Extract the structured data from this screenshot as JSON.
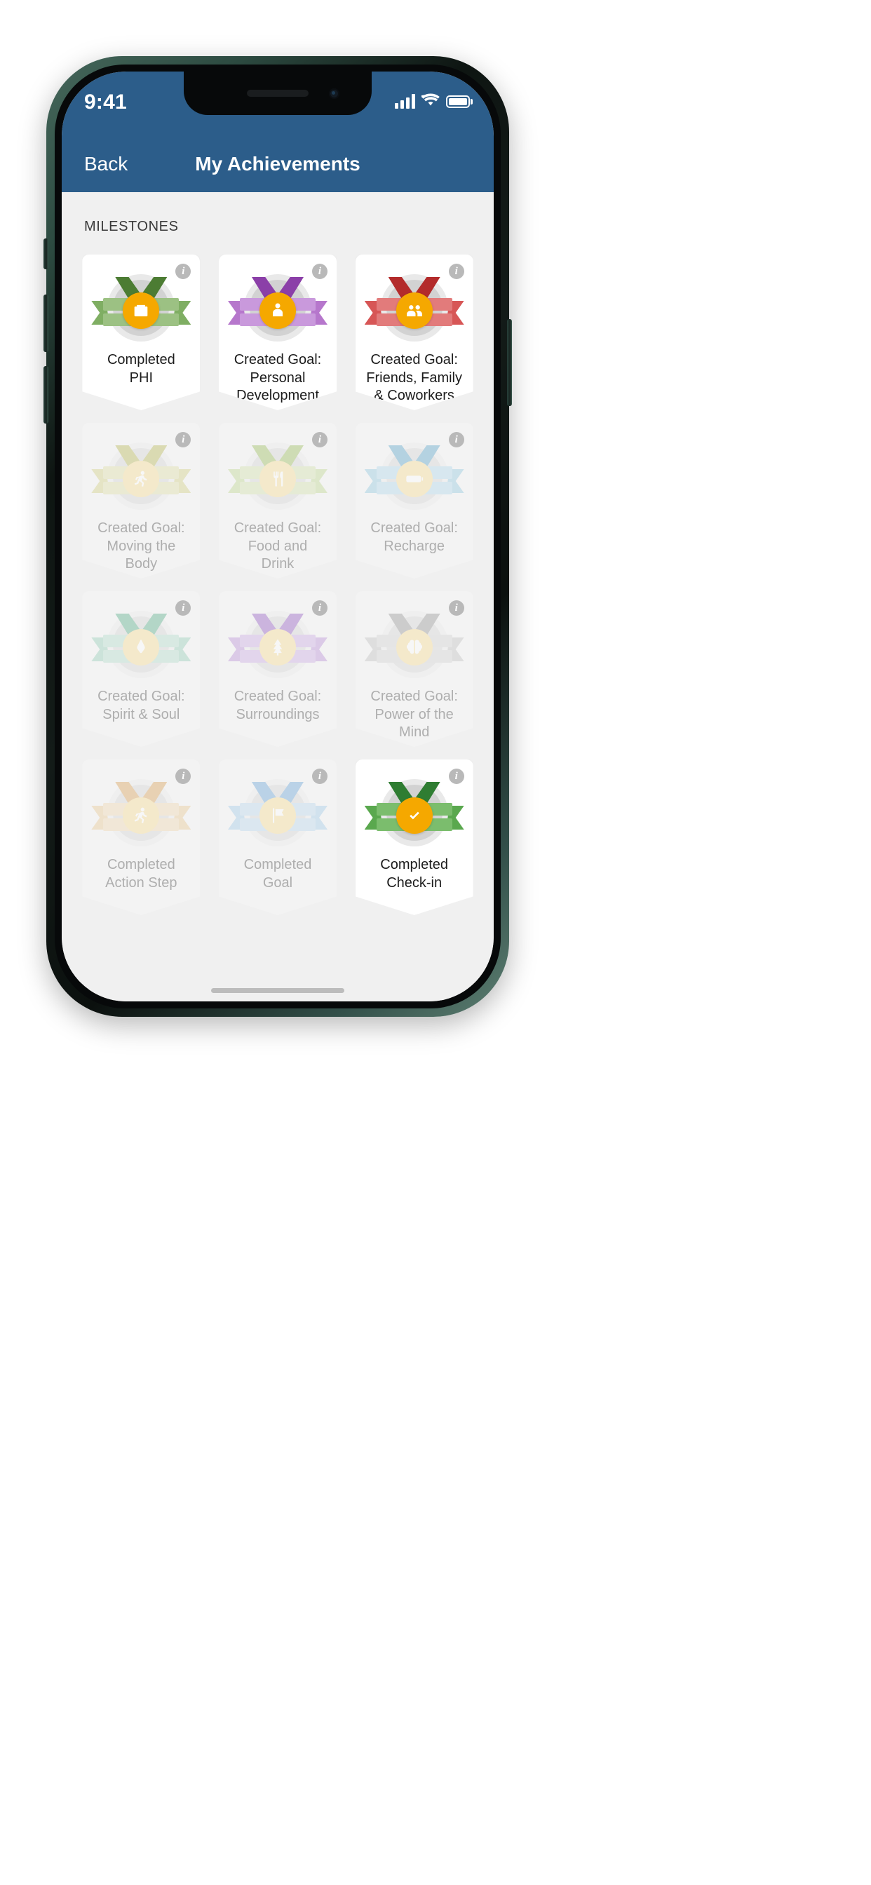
{
  "status_bar": {
    "time": "9:41",
    "signal_icon": "cellular-signal-icon",
    "wifi_icon": "wifi-icon",
    "battery_icon": "battery-full-icon"
  },
  "nav": {
    "back_label": "Back",
    "title": "My Achievements"
  },
  "section": {
    "title": "MILESTONES"
  },
  "colors": {
    "header_blue": "#2c5d8a",
    "screen_background": "#f0f0f0",
    "card_background": "#ffffff",
    "coin_gold": "#f5a800",
    "locked_text": "#aeaeae",
    "unlocked_text": "#1c1c1c"
  },
  "info_icon_label": "i",
  "badges": [
    {
      "label": "Completed\nPHI",
      "icon": "clipboard-icon",
      "locked": false,
      "ribbon_dark": "#4c7c33",
      "ribbon_mid": "#7fae63",
      "ribbon_light": "#9cc183"
    },
    {
      "label": "Created Goal:\nPersonal\nDevelopment",
      "icon": "person-growth-icon",
      "locked": false,
      "ribbon_dark": "#8b3fa8",
      "ribbon_mid": "#b677cc",
      "ribbon_light": "#c999dc"
    },
    {
      "label": "Created Goal:\nFriends, Family\n& Coworkers",
      "icon": "people-icon",
      "locked": false,
      "ribbon_dark": "#b32b2b",
      "ribbon_mid": "#d75656",
      "ribbon_light": "#e27b7b"
    },
    {
      "label": "Created Goal:\nMoving the\nBody",
      "icon": "running-person-icon",
      "locked": true,
      "ribbon_dark": "#b3b24a",
      "ribbon_mid": "#cfce7c",
      "ribbon_light": "#ddddA0"
    },
    {
      "label": "Created Goal:\nFood and\nDrink",
      "icon": "fork-knife-icon",
      "locked": true,
      "ribbon_dark": "#93b84f",
      "ribbon_mid": "#bcd489",
      "ribbon_light": "#cfe0a6"
    },
    {
      "label": "Created Goal:\nRecharge",
      "icon": "battery-charge-icon",
      "locked": true,
      "ribbon_dark": "#4f9fc4",
      "ribbon_mid": "#8cc5de",
      "ribbon_light": "#aad6e9"
    },
    {
      "label": "Created Goal:\nSpirit & Soul",
      "icon": "praying-hands-icon",
      "locked": true,
      "ribbon_dark": "#4ea882",
      "ribbon_mid": "#8fcbb2",
      "ribbon_light": "#aedbc7"
    },
    {
      "label": "Created Goal:\nSurroundings",
      "icon": "tree-icon",
      "locked": true,
      "ribbon_dark": "#8b50bd",
      "ribbon_mid": "#b68ad6",
      "ribbon_light": "#c9a7e2"
    },
    {
      "label": "Created Goal:\nPower of the\nMind",
      "icon": "brain-icon",
      "locked": true,
      "ribbon_dark": "#8e8e8e",
      "ribbon_mid": "#bdbdbd",
      "ribbon_light": "#d0d0d0"
    },
    {
      "label": "Completed\nAction Step",
      "icon": "running-person-icon",
      "locked": true,
      "ribbon_dark": "#d79c4e",
      "ribbon_mid": "#e8c48d",
      "ribbon_light": "#efd5ab"
    },
    {
      "label": "Completed\nGoal",
      "icon": "flag-icon",
      "locked": true,
      "ribbon_dark": "#5f9fd4",
      "ribbon_mid": "#9cc7e6",
      "ribbon_light": "#b5d6ed"
    },
    {
      "label": "Completed\nCheck-in",
      "icon": "check-circle-icon",
      "locked": false,
      "ribbon_dark": "#2f7d32",
      "ribbon_mid": "#5aa84e",
      "ribbon_light": "#7bbd6d"
    }
  ]
}
